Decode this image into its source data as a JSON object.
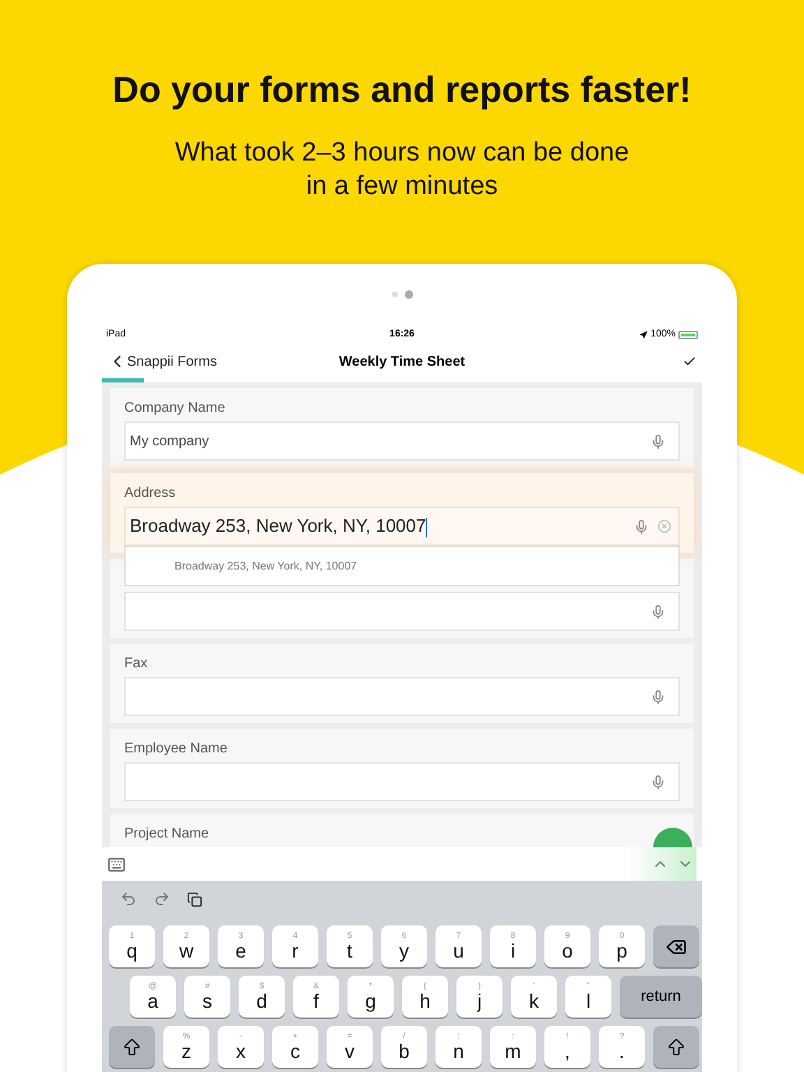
{
  "headline": "Do your forms and reports faster!",
  "subtitle": [
    "What took 2–3 hours now can be done",
    "in a few minutes"
  ],
  "page_dots": [
    {
      "selected": false
    },
    {
      "selected": true
    }
  ],
  "status_bar": {
    "device": "iPad",
    "time": "16:26",
    "battery": "100%"
  },
  "nav": {
    "back": "Snappii Forms",
    "title": "Weekly Time Sheet",
    "progress": {
      "level": 0.07
    }
  },
  "fields": [
    {
      "label": "Company Name",
      "value": "My company",
      "focused": false,
      "mic": true,
      "clear": false
    },
    {
      "label": "Address",
      "value": "Broadway 253, New York, NY, 10007",
      "focused": true,
      "mic": true,
      "clear": true,
      "suggestions": [
        "Broadway 253, New York, NY, 10007"
      ]
    },
    {
      "focused": false,
      "mic": true,
      "clear": false
    },
    {
      "label": "Fax",
      "focused": false,
      "mic": true,
      "clear": false
    },
    {
      "label": "Employee Name",
      "focused": false,
      "mic": true,
      "clear": false
    },
    {
      "label": "Project Name",
      "focused": false,
      "mic": false,
      "clear": false,
      "cut": true
    }
  ],
  "keyboard": {
    "rows": [
      {
        "indent": false,
        "keys": [
          {
            "kind": "char",
            "hint": "1",
            "label": "q"
          },
          {
            "kind": "char",
            "hint": "2",
            "label": "w"
          },
          {
            "kind": "char",
            "hint": "3",
            "label": "e"
          },
          {
            "kind": "char",
            "hint": "4",
            "label": "r"
          },
          {
            "kind": "char",
            "hint": "5",
            "label": "t"
          },
          {
            "kind": "char",
            "hint": "6",
            "label": "y"
          },
          {
            "kind": "char",
            "hint": "7",
            "label": "u"
          },
          {
            "kind": "char",
            "hint": "8",
            "label": "i"
          },
          {
            "kind": "char",
            "hint": "9",
            "label": "o"
          },
          {
            "kind": "char",
            "hint": "0",
            "label": "p"
          },
          {
            "kind": "backspace"
          }
        ]
      },
      {
        "indent": true,
        "keys": [
          {
            "kind": "char",
            "hint": "@",
            "label": "a"
          },
          {
            "kind": "char",
            "hint": "#",
            "label": "s"
          },
          {
            "kind": "char",
            "hint": "$",
            "label": "d"
          },
          {
            "kind": "char",
            "hint": "&",
            "label": "f"
          },
          {
            "kind": "char",
            "hint": "*",
            "label": "g"
          },
          {
            "kind": "char",
            "hint": "(",
            "label": "h"
          },
          {
            "kind": "char",
            "hint": ")",
            "label": "j"
          },
          {
            "kind": "char",
            "hint": "'",
            "label": "k"
          },
          {
            "kind": "char",
            "hint": "\"",
            "label": "l"
          },
          {
            "kind": "action",
            "label": "return"
          }
        ]
      },
      {
        "indent": false,
        "keys": [
          {
            "kind": "shift"
          },
          {
            "kind": "char",
            "hint": "%",
            "label": "z"
          },
          {
            "kind": "char",
            "hint": "-",
            "label": "x"
          },
          {
            "kind": "char",
            "hint": "+",
            "label": "c"
          },
          {
            "kind": "char",
            "hint": "=",
            "label": "v"
          },
          {
            "kind": "char",
            "hint": "/",
            "label": "b"
          },
          {
            "kind": "char",
            "hint": ";",
            "label": "n"
          },
          {
            "kind": "char",
            "hint": ":",
            "label": "m"
          },
          {
            "kind": "char",
            "hint": "!",
            "label": ","
          },
          {
            "kind": "char",
            "hint": "?",
            "label": "."
          },
          {
            "kind": "shift"
          }
        ]
      }
    ]
  }
}
